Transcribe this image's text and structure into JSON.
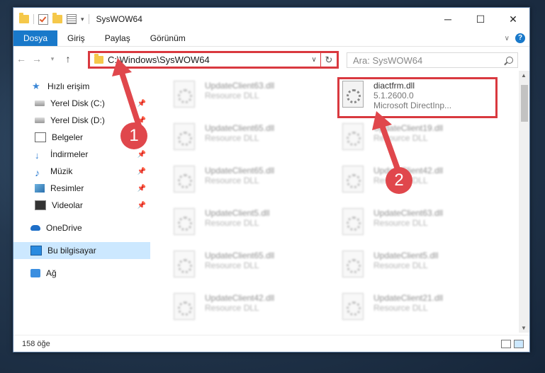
{
  "window": {
    "title": "SysWOW64"
  },
  "ribbon": {
    "tabs": [
      "Dosya",
      "Giriş",
      "Paylaş",
      "Görünüm"
    ]
  },
  "address": {
    "path": "C:\\Windows\\SysWOW64"
  },
  "search": {
    "placeholder": "Ara: SysWOW64"
  },
  "sidebar": {
    "items": [
      {
        "label": "Hızlı erişim"
      },
      {
        "label": "Yerel Disk (C:)"
      },
      {
        "label": "Yerel Disk (D:)"
      },
      {
        "label": "Belgeler"
      },
      {
        "label": "İndirmeler"
      },
      {
        "label": "Müzik"
      },
      {
        "label": "Resimler"
      },
      {
        "label": "Videolar"
      },
      {
        "label": "OneDrive"
      },
      {
        "label": "Bu bilgisayar"
      },
      {
        "label": "Ağ"
      }
    ]
  },
  "highlighted_file": {
    "name": "diactfrm.dll",
    "version": "5.1.2600.0",
    "description": "Microsoft DirectInp..."
  },
  "files": [
    {
      "name": "UpdateClient63.dll",
      "desc": "Resource DLL"
    },
    {
      "name": "UpdateClient65.dll",
      "desc": "Resource DLL"
    },
    {
      "name": "UpdateClient19.dll",
      "desc": "Resource DLL"
    },
    {
      "name": "UpdateClient65.dll",
      "desc": "Resource DLL"
    },
    {
      "name": "UpdateClient42.dll",
      "desc": "Resource DLL"
    },
    {
      "name": "UpdateClient5.dll",
      "desc": "Resource DLL"
    },
    {
      "name": "UpdateClient63.dll",
      "desc": "Resource DLL"
    },
    {
      "name": "UpdateClient65.dll",
      "desc": "Resource DLL"
    },
    {
      "name": "UpdateClient5.dll",
      "desc": "Resource DLL"
    },
    {
      "name": "UpdateClient42.dll",
      "desc": "Resource DLL"
    },
    {
      "name": "UpdateClient21.dll",
      "desc": "Resource DLL"
    }
  ],
  "status": {
    "count": "158 öğe"
  },
  "annotations": {
    "step1": "1",
    "step2": "2"
  },
  "colors": {
    "accent": "#1979ca",
    "annotation": "#d9393f"
  }
}
